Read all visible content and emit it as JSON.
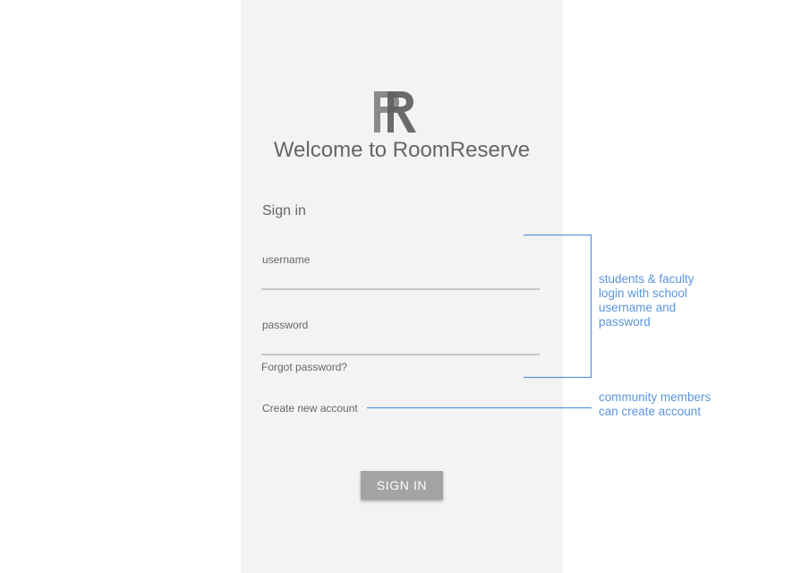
{
  "colors": {
    "panel_bg": "#f3f3f3",
    "text_gray": "#666666",
    "button_bg": "#a3a3a3",
    "annotation_blue": "#5b95dc"
  },
  "logo": {
    "icon": "roomreserve-logo-icon",
    "letters": "RR"
  },
  "welcome_title": "Welcome to RoomReserve",
  "signin": {
    "heading": "Sign in",
    "username_label": "username",
    "username_value": "",
    "password_label": "password",
    "password_value": "",
    "forgot_link": "Forgot password?",
    "create_account_link": "Create new account",
    "button_label": "SIGN IN"
  },
  "annotations": {
    "login_note": [
      "students & faculty",
      "login with school",
      "username and",
      "password"
    ],
    "create_note": [
      "community members",
      "can create account"
    ]
  }
}
